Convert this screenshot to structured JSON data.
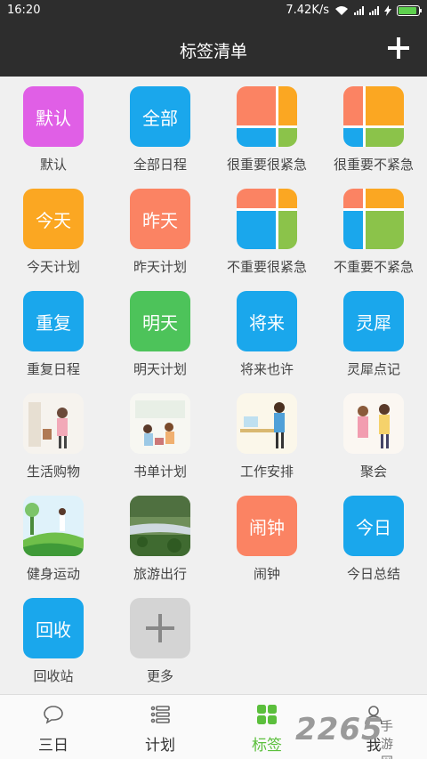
{
  "status": {
    "time": "16:20",
    "speed": "7.42K/s",
    "battery_level": 0.9
  },
  "header": {
    "title": "标签清单"
  },
  "tags": [
    {
      "label": "默认",
      "text": "默认",
      "kind": "text",
      "color": "#e05fe6"
    },
    {
      "label": "全部日程",
      "text": "全部",
      "kind": "text",
      "color": "#1aa7ec"
    },
    {
      "label": "很重要很紧急",
      "kind": "quad",
      "highlight": "tl"
    },
    {
      "label": "很重要不紧急",
      "kind": "quad",
      "highlight": "tr"
    },
    {
      "label": "今天计划",
      "text": "今天",
      "kind": "text",
      "color": "#fba722"
    },
    {
      "label": "昨天计划",
      "text": "昨天",
      "kind": "text",
      "color": "#fb8363"
    },
    {
      "label": "不重要很紧急",
      "kind": "quad",
      "highlight": "bl"
    },
    {
      "label": "不重要不紧急",
      "kind": "quad",
      "highlight": "br"
    },
    {
      "label": "重复日程",
      "text": "重复",
      "kind": "text",
      "color": "#1aa7ec"
    },
    {
      "label": "明天计划",
      "text": "明天",
      "kind": "text",
      "color": "#4dc35a"
    },
    {
      "label": "将来也许",
      "text": "将来",
      "kind": "text",
      "color": "#1aa7ec"
    },
    {
      "label": "灵犀点记",
      "text": "灵犀",
      "kind": "text",
      "color": "#1aa7ec"
    },
    {
      "label": "生活购物",
      "kind": "img",
      "icon": "shopping-illustration"
    },
    {
      "label": "书单计划",
      "kind": "img",
      "icon": "reading-illustration"
    },
    {
      "label": "工作安排",
      "kind": "img",
      "icon": "office-illustration"
    },
    {
      "label": "聚会",
      "kind": "img",
      "icon": "party-illustration"
    },
    {
      "label": "健身运动",
      "kind": "img",
      "icon": "fitness-illustration"
    },
    {
      "label": "旅游出行",
      "kind": "img",
      "icon": "travel-photo"
    },
    {
      "label": "闹钟",
      "text": "闹钟",
      "kind": "text",
      "color": "#fb8363"
    },
    {
      "label": "今日总结",
      "text": "今日",
      "kind": "text",
      "color": "#1aa7ec"
    },
    {
      "label": "回收站",
      "text": "回收",
      "kind": "text",
      "color": "#1aa7ec"
    },
    {
      "label": "更多",
      "kind": "more",
      "icon": "plus-icon"
    }
  ],
  "quad_colors": {
    "tl": "#fb8363",
    "tr": "#fba722",
    "bl": "#1aa7ec",
    "br": "#8bc34a"
  },
  "tabs": [
    {
      "label": "三日",
      "icon": "chat-bubble-icon",
      "active": false
    },
    {
      "label": "计划",
      "icon": "list-icon",
      "active": false
    },
    {
      "label": "标签",
      "icon": "grid-icon",
      "active": true
    },
    {
      "label": "我",
      "icon": "person-icon",
      "active": false
    }
  ],
  "watermark": {
    "text": "2265",
    "sub": "手游网"
  },
  "colors": {
    "accent": "#5bbf3c",
    "bar": "#2d2d2d"
  }
}
